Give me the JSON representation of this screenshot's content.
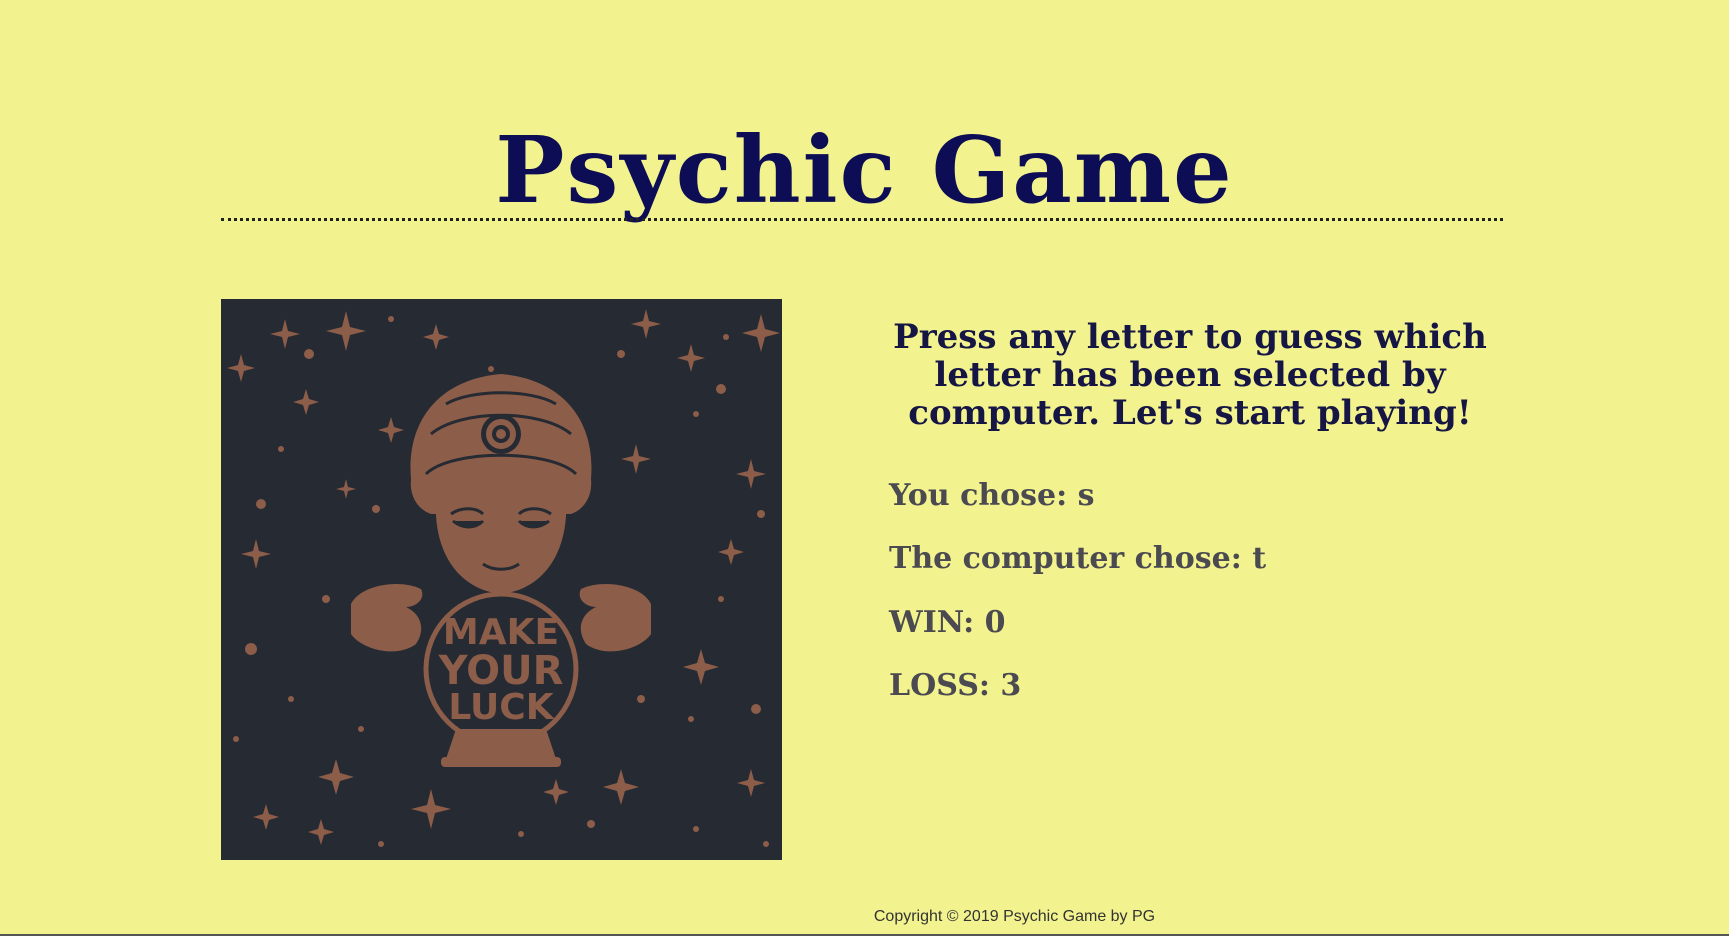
{
  "header": {
    "title": "Psychic Game"
  },
  "image": {
    "emblem_text": [
      "MAKE",
      "YOUR",
      "LUCK"
    ],
    "colors": {
      "background": "#262a33",
      "figure": "#8c5d49"
    }
  },
  "game": {
    "instructions": "Press any letter to guess which letter has been selected by computer. Let's start playing!",
    "you_chose": "You chose: s",
    "computer_chose": "The computer chose: t",
    "wins": "WIN: 0",
    "losses": "LOSS: 3"
  },
  "footer": {
    "copyright": "Copyright © 2019 Psychic Game by PG"
  },
  "colors": {
    "page_background": "#f2f28f",
    "title": "#0d0d55",
    "instructions": "#161645",
    "stats": "#4a4a50"
  }
}
